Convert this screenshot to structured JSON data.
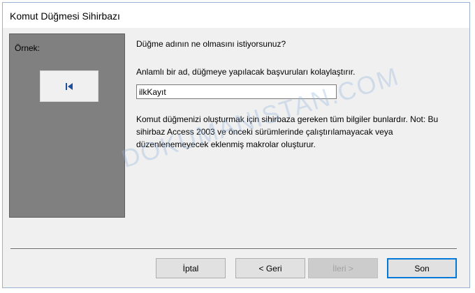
{
  "window": {
    "title": "Komut Düğmesi Sihirbazı"
  },
  "preview": {
    "label": "Örnek:",
    "button_icon": "first-record-icon"
  },
  "content": {
    "question": "Düğme adının ne olmasını istiyorsunuz?",
    "description": "Anlamlı bir ad, düğmeye yapılacak başvuruları kolaylaştırır.",
    "name_value": "ilkKayıt",
    "info": "Komut düğmenizi oluşturmak için sihirbaza gereken tüm bilgiler bunlardır. Not: Bu sihirbaz Access 2003 ve önceki sürümlerinde çalıştırılamayacak veya düzenlenemeyecek eklenmiş makrolar oluşturur."
  },
  "watermark": "DOKUMANISTAN.COM",
  "buttons": {
    "cancel": "İptal",
    "back": "< Geri",
    "next": "İleri >",
    "finish": "Son"
  },
  "colors": {
    "preview_bg": "#808080",
    "icon": "#1f4e9c",
    "finish_border": "#0078d7"
  }
}
